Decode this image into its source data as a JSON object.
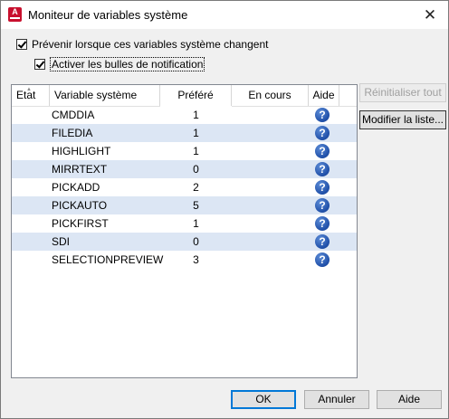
{
  "window": {
    "title": "Moniteur de variables système",
    "close_glyph": "✕",
    "icon": "autocad-app-icon"
  },
  "options": {
    "prevent_label": "Prévenir lorsque ces variables système changent",
    "notify_label": "Activer les bulles de notification",
    "prevent_checked": true,
    "notify_checked": true
  },
  "table": {
    "columns": [
      "Etat",
      "Variable système",
      "Préféré",
      "En cours",
      "Aide"
    ],
    "help_glyph": "?",
    "rows": [
      {
        "name": "CMDDIA",
        "preferred": "1",
        "current": ""
      },
      {
        "name": "FILEDIA",
        "preferred": "1",
        "current": ""
      },
      {
        "name": "HIGHLIGHT",
        "preferred": "1",
        "current": ""
      },
      {
        "name": "MIRRTEXT",
        "preferred": "0",
        "current": ""
      },
      {
        "name": "PICKADD",
        "preferred": "2",
        "current": ""
      },
      {
        "name": "PICKAUTO",
        "preferred": "5",
        "current": ""
      },
      {
        "name": "PICKFIRST",
        "preferred": "1",
        "current": ""
      },
      {
        "name": "SDI",
        "preferred": "0",
        "current": ""
      },
      {
        "name": "SELECTIONPREVIEW",
        "preferred": "3",
        "current": ""
      }
    ]
  },
  "side_buttons": {
    "reset": "Réinitialiser tout",
    "modify": "Modifier la liste..."
  },
  "footer": {
    "ok": "OK",
    "cancel": "Annuler",
    "help": "Aide"
  },
  "colors": {
    "alt_row": "#dce6f4",
    "help_icon": "#1f4fa8",
    "accent": "#0078d7"
  }
}
